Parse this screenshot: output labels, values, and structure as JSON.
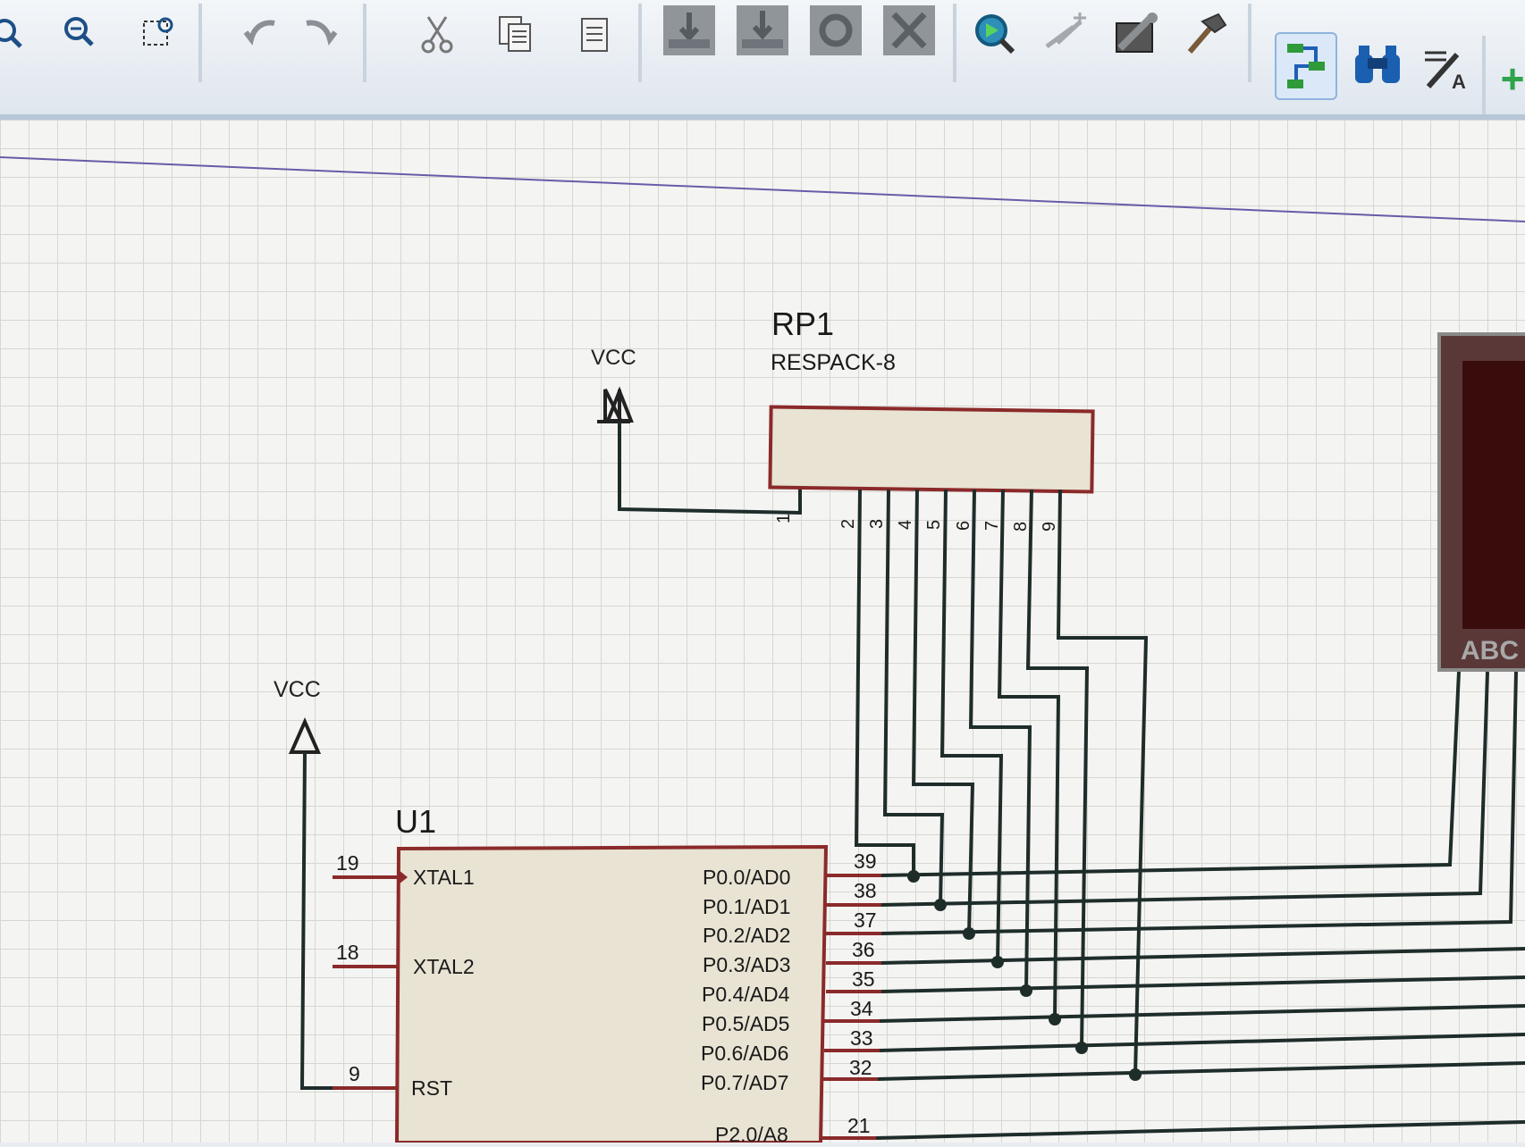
{
  "toolbar": {
    "buttons": [
      {
        "icon": "zoom-area-icon"
      },
      {
        "icon": "zoom-out-icon"
      },
      {
        "icon": "select-area-icon"
      },
      {
        "icon": "undo-icon"
      },
      {
        "icon": "redo-icon"
      },
      {
        "icon": "cut-icon"
      },
      {
        "icon": "copy-icon"
      },
      {
        "icon": "paste-icon"
      },
      {
        "icon": "block-copy-icon"
      },
      {
        "icon": "block-move-icon"
      },
      {
        "icon": "block-rotate-icon"
      },
      {
        "icon": "block-delete-icon"
      },
      {
        "icon": "zoom-to-component-icon"
      },
      {
        "icon": "pick-device-icon"
      },
      {
        "icon": "make-device-icon"
      },
      {
        "icon": "decompose-icon"
      },
      {
        "icon": "wire-autorouter-icon"
      },
      {
        "icon": "search-tag-icon"
      },
      {
        "icon": "property-assignment-tool-icon"
      },
      {
        "icon": "new-sheet-icon"
      }
    ],
    "plus_label": "+"
  },
  "schematic": {
    "rp1": {
      "ref": "RP1",
      "value": "RESPACK-8",
      "pins": [
        "1",
        "2",
        "3",
        "4",
        "5",
        "6",
        "7",
        "8",
        "9"
      ]
    },
    "vcc_top": "VCC",
    "vcc_left": "VCC",
    "u1": {
      "ref": "U1",
      "left_pins": [
        {
          "num": "19",
          "name": "XTAL1"
        },
        {
          "num": "18",
          "name": "XTAL2"
        },
        {
          "num": "9",
          "name": "RST"
        }
      ],
      "right_pins": [
        {
          "num": "39",
          "name": "P0.0/AD0"
        },
        {
          "num": "38",
          "name": "P0.1/AD1"
        },
        {
          "num": "37",
          "name": "P0.2/AD2"
        },
        {
          "num": "36",
          "name": "P0.3/AD3"
        },
        {
          "num": "35",
          "name": "P0.4/AD4"
        },
        {
          "num": "34",
          "name": "P0.5/AD5"
        },
        {
          "num": "33",
          "name": "P0.6/AD6"
        },
        {
          "num": "32",
          "name": "P0.7/AD7"
        },
        {
          "num": "21",
          "name": "P2.0/A8"
        }
      ]
    },
    "display_label": "ABC"
  },
  "colors": {
    "wire": "#1e2d2a",
    "pin": "#8b2a2a",
    "component_fill": "#e8e3d3",
    "component_border": "#8b2a2a",
    "display_body": "#5b3838",
    "display_glass": "#3a0d0d"
  }
}
